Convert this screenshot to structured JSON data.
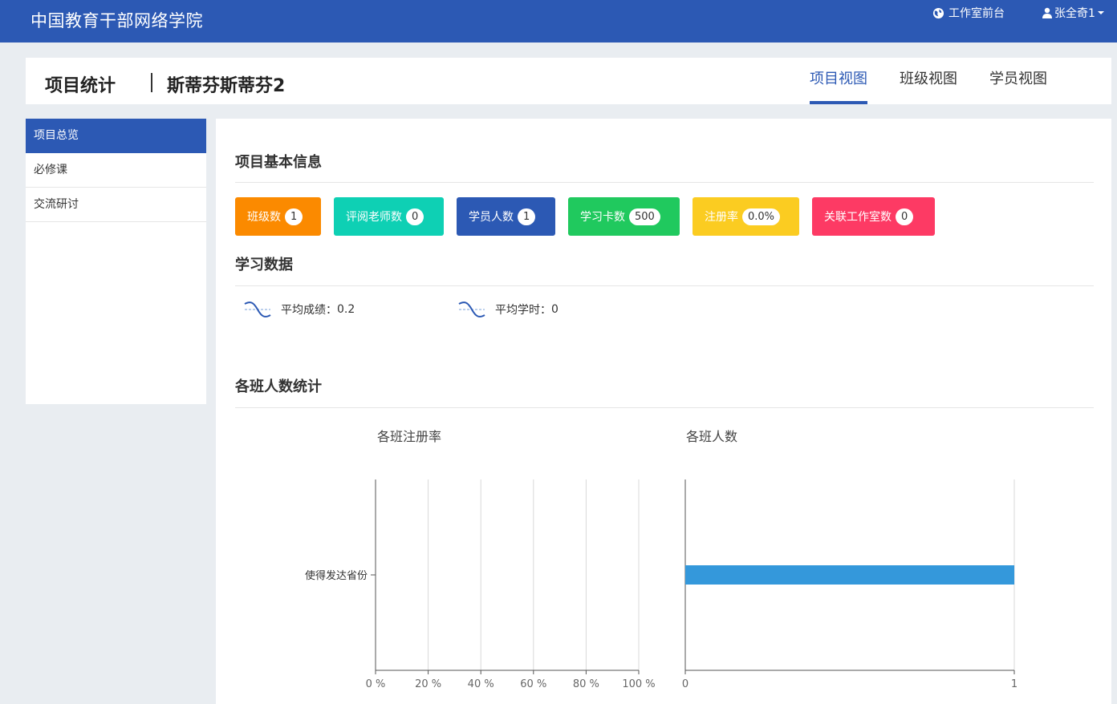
{
  "topbar": {
    "brand": "中国教育干部网络学院",
    "studio_link": "工作室前台",
    "user_name": "张全奇1",
    "studio_icon": "globe-icon",
    "user_icon": "user-icon",
    "bg_color": "#2c59b4"
  },
  "header": {
    "title": "项目统计",
    "project_name": "斯蒂芬斯蒂芬2",
    "tabs": [
      {
        "label": "项目视图",
        "active": true
      },
      {
        "label": "班级视图",
        "active": false
      },
      {
        "label": "学员视图",
        "active": false
      }
    ]
  },
  "sidebar": {
    "items": [
      {
        "label": "项目总览",
        "active": true
      },
      {
        "label": "必修课",
        "active": false
      },
      {
        "label": "交流研讨",
        "active": false
      }
    ]
  },
  "basic_info": {
    "title": "项目基本信息",
    "stats": [
      {
        "label": "班级数",
        "value": "1",
        "color": "#fb8a00"
      },
      {
        "label": "评阅老师数",
        "value": "0",
        "color": "#0ed0b4"
      },
      {
        "label": "学员人数",
        "value": "1",
        "color": "#2c59b4"
      },
      {
        "label": "学习卡数",
        "value": "500",
        "color": "#20c95e"
      },
      {
        "label": "注册率",
        "value": "0.0%",
        "color": "#fbcc21"
      },
      {
        "label": "关联工作室数",
        "value": "0",
        "color": "#fd3a64"
      }
    ]
  },
  "learning": {
    "title": "学习数据",
    "metrics": [
      {
        "label": "平均成绩：",
        "value": "0.2",
        "icon": "wave-icon"
      },
      {
        "label": "平均学时：",
        "value": "0",
        "icon": "wave-icon"
      }
    ]
  },
  "class_stats": {
    "title": "各班人数统计"
  },
  "chart_data": [
    {
      "type": "bar",
      "orientation": "horizontal",
      "title": "各班注册率",
      "categories": [
        "使得发达省份"
      ],
      "values": [
        0
      ],
      "xlim": [
        0,
        100
      ],
      "xticks": [
        "0 %",
        "20 %",
        "40 %",
        "60 %",
        "80 %",
        "100 %"
      ],
      "grid": true,
      "color": "#3498db"
    },
    {
      "type": "bar",
      "orientation": "horizontal",
      "title": "各班人数",
      "categories": [
        "使得发达省份"
      ],
      "values": [
        1
      ],
      "xlim": [
        0,
        1
      ],
      "xticks": [
        "0",
        "1"
      ],
      "grid": true,
      "color": "#3498db"
    }
  ]
}
